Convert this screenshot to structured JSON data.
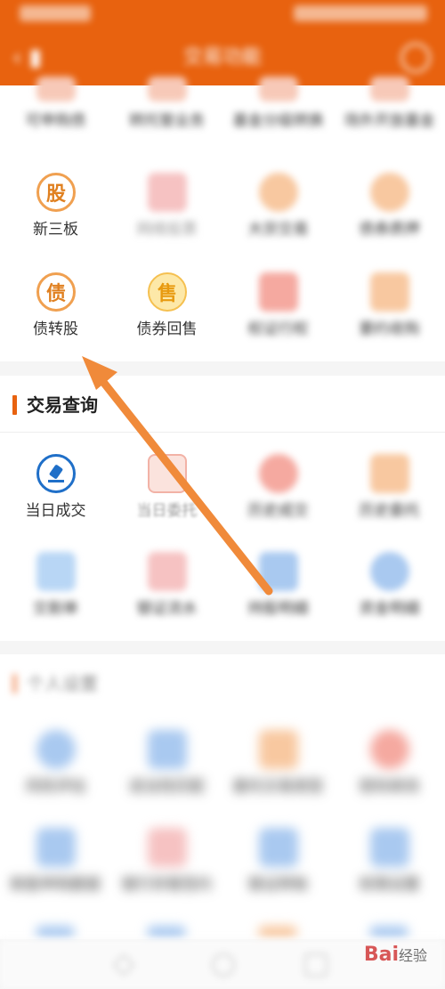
{
  "header": {
    "title": "交易功能",
    "back_icon": "back-arrow-icon",
    "right_icon": "settings-icon"
  },
  "section1": {
    "row1_labels": [
      "可申购债",
      "转托管业务",
      "基金分级转换",
      "场外开放基金"
    ],
    "row2": [
      {
        "label": "新三板",
        "icon_glyph": "股"
      },
      {
        "label": "网络投票"
      },
      {
        "label": "大宗交易"
      },
      {
        "label": "债券质押"
      }
    ],
    "row3": [
      {
        "label": "债转股",
        "icon_glyph": "债"
      },
      {
        "label": "债券回售",
        "icon_glyph": "售"
      },
      {
        "label": "权证行权"
      },
      {
        "label": "要约收购"
      }
    ]
  },
  "section2": {
    "title": "交易查询",
    "row1": [
      {
        "label": "当日成交"
      },
      {
        "label": "当日委托"
      },
      {
        "label": "历史成交"
      },
      {
        "label": "历史委托"
      }
    ],
    "row2_labels": [
      "交割单",
      "银证流水",
      "持股明细",
      "资金明细"
    ]
  },
  "section3": {
    "title": "个人设置",
    "row1_labels": [
      "风险评估",
      "适当性匹配",
      "委托交易类型",
      "密码修改"
    ],
    "row2_labels": [
      "新股申购额度",
      "银行存管签约",
      "银证转账",
      "权限设置"
    ]
  },
  "watermark": {
    "brand": "Bai",
    "suffix": "经验"
  },
  "colors": {
    "brand": "#e8620f",
    "accent_blue": "#1f6fc8",
    "arrow": "#f08a3a"
  }
}
